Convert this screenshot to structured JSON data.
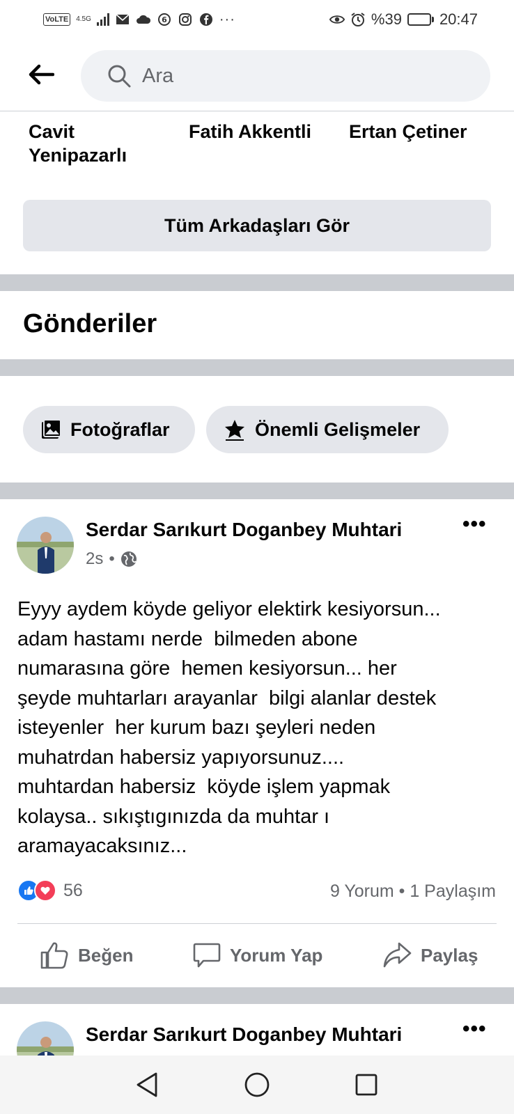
{
  "status_bar": {
    "volte": "VoLTE",
    "network": "4.5G",
    "battery_percent": "%39",
    "battery_level": 0.39,
    "time": "20:47"
  },
  "search": {
    "placeholder": "Ara"
  },
  "friends": [
    {
      "name": "Cavit Yenipazarlı"
    },
    {
      "name": "Fatih Akkentli"
    },
    {
      "name": "Ertan Çetiner"
    }
  ],
  "see_all_friends": "Tüm Arkadaşları Gör",
  "posts_section": {
    "title": "Gönderiler",
    "filters": [
      {
        "label": "Fotoğraflar",
        "icon": "photos-icon"
      },
      {
        "label": "Önemli Gelişmeler",
        "icon": "star-icon"
      }
    ]
  },
  "posts": [
    {
      "author": "Serdar Sarıkurt Doganbey Muhtari",
      "time": "2s",
      "audience_icon": "globe-icon",
      "text": "Eyyy aydem köyde geliyor elektirk kesiyorsun...\nadam hastamı nerde  bilmeden abone\nnumarasına göre  hemen kesiyorsun... her\nşeyde muhtarları arayanlar  bilgi alanlar destek\nisteyenler  her kurum bazı şeyleri neden\nmuhatrdan habersiz yapıyorsunuz....\nmuhtardan habersiz  köyde işlem yapmak\nkolaysa.. sıkıştıgınızda da muhtar ı\naramayacaksınız...",
      "reaction_count": "56",
      "stats": "9 Yorum • 1 Paylaşım",
      "actions": {
        "like": "Beğen",
        "comment": "Yorum Yap",
        "share": "Paylaş"
      }
    },
    {
      "author": "Serdar Sarıkurt Doganbey Muhtari"
    }
  ],
  "colors": {
    "divider": "#c9ccd1",
    "chip_bg": "#e4e6eb",
    "like_blue": "#1877f2",
    "love_red": "#f33e58",
    "secondary_text": "#65676b"
  }
}
